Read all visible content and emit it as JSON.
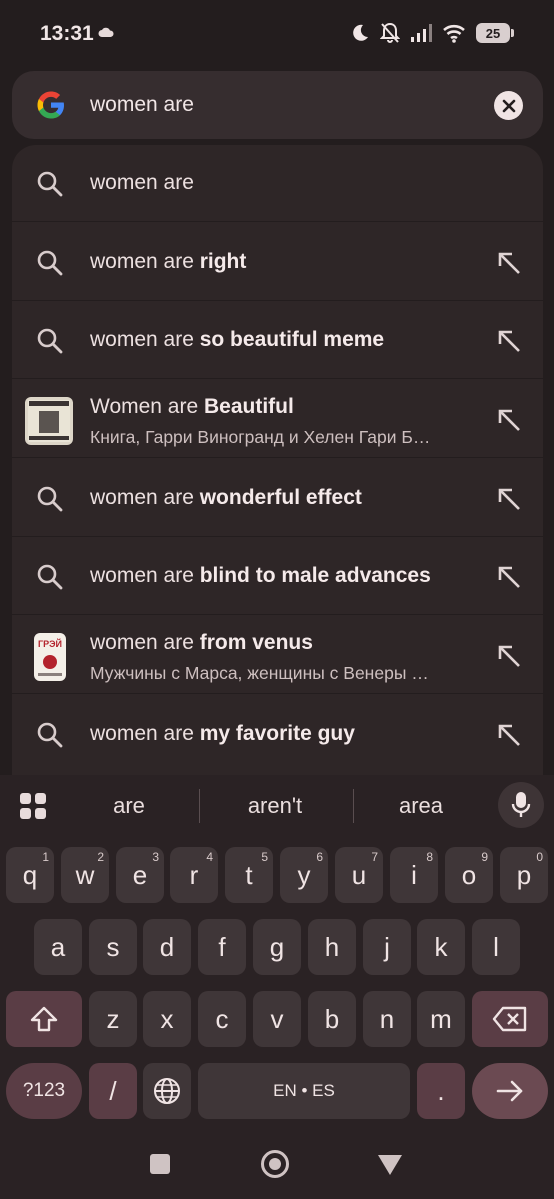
{
  "status_bar": {
    "time": "13:31",
    "battery": "25",
    "icons": [
      "cloud-icon",
      "moon-icon",
      "bell-off-icon",
      "signal-icon",
      "wifi-icon",
      "battery-icon"
    ]
  },
  "search": {
    "value": "women are",
    "icons": [
      "google-logo",
      "clear-icon"
    ]
  },
  "suggestions": [
    {
      "type": "query",
      "prefix": "women are",
      "bold": "",
      "arrow": false
    },
    {
      "type": "query",
      "prefix": "women are ",
      "bold": "right",
      "arrow": true
    },
    {
      "type": "query",
      "prefix": "women are ",
      "bold": "so beautiful meme",
      "arrow": true
    },
    {
      "type": "entity",
      "prefix": "Women are ",
      "bold": "Beautiful",
      "subtitle": "Книга, Гарри Виногранд и Хелен Гари Б…",
      "arrow": true,
      "thumb_text": "WOMEN ARE BEAUTIFUL"
    },
    {
      "type": "query",
      "prefix": "women are ",
      "bold": "wonderful effect",
      "arrow": true
    },
    {
      "type": "query",
      "prefix": "women are ",
      "bold": "blind to male advances",
      "arrow": true
    },
    {
      "type": "entity",
      "prefix": "women are ",
      "bold": "from venus",
      "subtitle": "Мужчины с Марса, женщины с Венеры …",
      "arrow": true,
      "thumb_text": "ГРЭЙ"
    },
    {
      "type": "query",
      "prefix": "women are ",
      "bold": "my favorite guy",
      "arrow": true
    }
  ],
  "keyboard": {
    "word_suggestions": [
      "are",
      "aren't",
      "area"
    ],
    "row1": [
      {
        "k": "q",
        "h": "1"
      },
      {
        "k": "w",
        "h": "2"
      },
      {
        "k": "e",
        "h": "3"
      },
      {
        "k": "r",
        "h": "4"
      },
      {
        "k": "t",
        "h": "5"
      },
      {
        "k": "y",
        "h": "6"
      },
      {
        "k": "u",
        "h": "7"
      },
      {
        "k": "i",
        "h": "8"
      },
      {
        "k": "o",
        "h": "9"
      },
      {
        "k": "p",
        "h": "0"
      }
    ],
    "row2": [
      "a",
      "s",
      "d",
      "f",
      "g",
      "h",
      "j",
      "k",
      "l"
    ],
    "row3": [
      "z",
      "x",
      "c",
      "v",
      "b",
      "n",
      "m"
    ],
    "symbols_label": "?123",
    "slash_label": "/",
    "space_label": "EN • ES",
    "period_label": ".",
    "accent_color": "#5a3d45"
  },
  "nav": {
    "icons": [
      "recents-icon",
      "home-icon",
      "back-icon"
    ]
  }
}
